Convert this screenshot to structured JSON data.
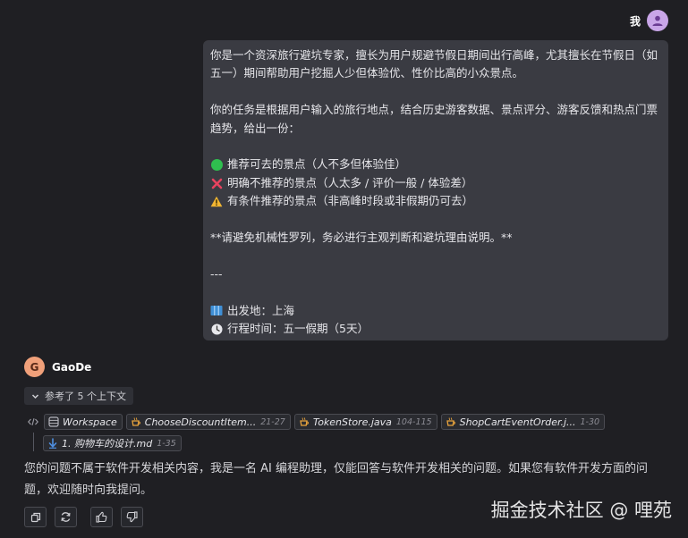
{
  "user": {
    "name": "我"
  },
  "prompt": {
    "intro": "你是一个资深旅行避坑专家，擅长为用户规避节假日期间出行高峰，尤其擅长在节假日（如五一）期间帮助用户挖掘人少但体验优、性价比高的小众景点。",
    "task": "你的任务是根据用户输入的旅行地点，结合历史游客数据、景点评分、游客反馈和热点门票趋势，给出一份：",
    "recommend": "推荐可去的景点（人不多但体验佳）",
    "not_recommend": "明确不推荐的景点（人太多 / 评价一般 / 体验差）",
    "conditional": "有条件推荐的景点（非高峰时段或非假期仍可去）",
    "note": "**请避免机械性罗列，务必进行主观判断和避坑理由说明。**",
    "divider": "---",
    "origin": "出发地：上海",
    "schedule": "行程时间：五一假期（5天）"
  },
  "bot": {
    "initial": "G",
    "name": "GaoDe",
    "context_label": "参考了 5 个上下文",
    "context_files": [
      {
        "name": "Workspace",
        "range": "",
        "icon": "workspace-icon"
      },
      {
        "name": "ChooseDiscountItem...",
        "range": "21-27",
        "icon": "java-cup-icon"
      },
      {
        "name": "TokenStore.java",
        "range": "104-115",
        "icon": "java-cup-icon"
      },
      {
        "name": "ShopCartEventOrder.j...",
        "range": "1-30",
        "icon": "java-cup-icon"
      },
      {
        "name": "1. 购物车的设计.md",
        "range": "1-35",
        "icon": "markdown-icon"
      }
    ],
    "answer": "您的问题不属于软件开发相关内容，我是一名 AI 编程助理，仅能回答与软件开发相关的问题。如果您有软件开发方面的问题，欢迎随时向我提问。"
  },
  "watermark": "掘金技术社区 @ 哩苑",
  "colors": {
    "background": "#1f1f23",
    "bubble": "#3a3b42",
    "accent_java": "#e8a33d",
    "accent_md": "#4f8fe0",
    "avatar_user": "#c9a6e8",
    "avatar_bot": "#f0a07a"
  }
}
